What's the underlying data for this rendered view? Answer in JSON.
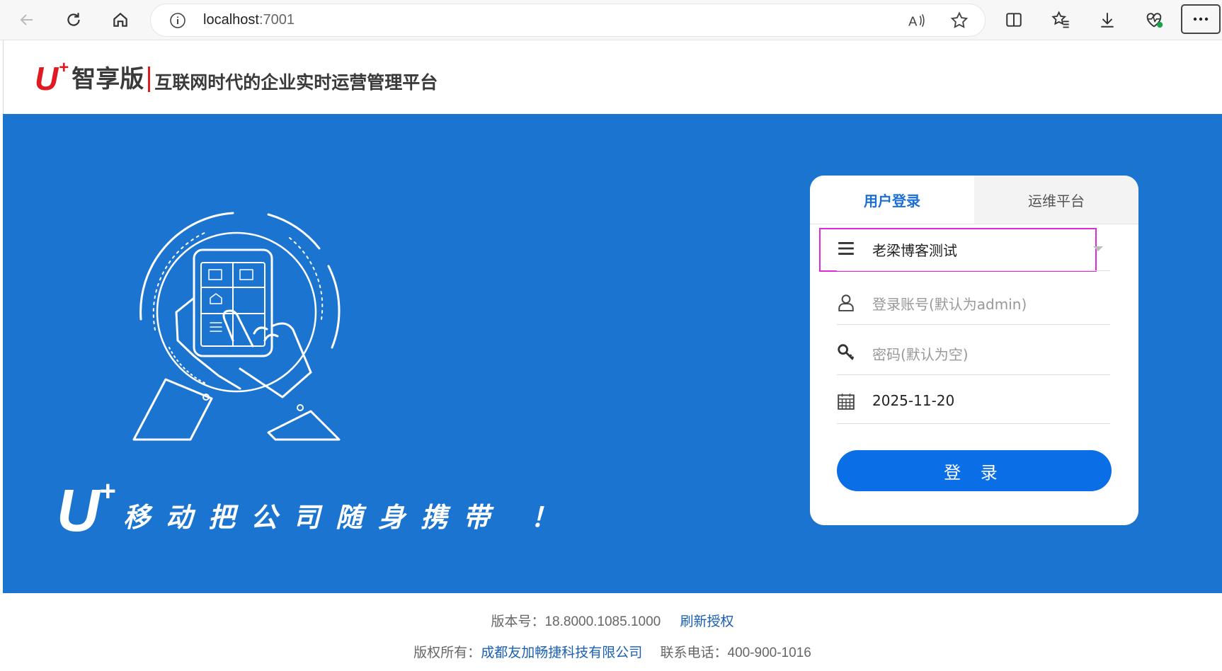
{
  "browser": {
    "url_host": "localhost",
    "url_port": ":7001"
  },
  "header": {
    "logo_u": "U",
    "logo_plus": "+",
    "logo_name": "智享版",
    "slogan": "互联网时代的企业实时运营管理平台"
  },
  "banner": {
    "tag_u": "U",
    "tag_plus": "+",
    "tagline": "移动把公司随身携带 ！"
  },
  "login": {
    "tabs": [
      {
        "label": "用户登录",
        "active": true
      },
      {
        "label": "运维平台",
        "active": false
      }
    ],
    "company_value": "老梁博客测试",
    "account_placeholder": "登录账号(默认为admin)",
    "password_placeholder": "密码(默认为空)",
    "date_value": "2025-11-20",
    "submit_label": "登 录"
  },
  "footer": {
    "version_label": "版本号：",
    "version_value": "18.8000.1085.1000",
    "refresh_link": "刷新授权",
    "copyright_label": "版权所有：",
    "company_link": "成都友加畅捷科技有限公司",
    "phone_label": "联系电话：",
    "phone_value": "400-900-1016"
  },
  "colors": {
    "banner_blue": "#1a74d0",
    "brand_red": "#e01a22",
    "primary_button": "#0a6ee6",
    "highlight_magenta": "#e02ad8"
  }
}
